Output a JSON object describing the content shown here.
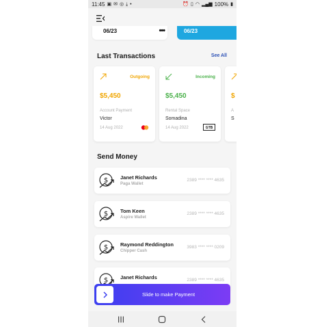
{
  "status_bar": {
    "time": "11:45",
    "battery": "100%",
    "left_icons": [
      "image-icon",
      "message-icon",
      "whatsapp-icon",
      "download-icon",
      "dot-icon"
    ],
    "right_icons": [
      "alarm-icon",
      "vibrate-icon",
      "wifi-icon",
      "signal-icon",
      "battery-icon"
    ]
  },
  "cards": {
    "left_expiry": "06/23",
    "left_mask": "•••",
    "right_expiry": "06/23",
    "right_color": "#1ea7e0"
  },
  "transactions": {
    "title": "Last Transactions",
    "see_all": "See All",
    "items": [
      {
        "type": "Outgoing",
        "amount": "$5,450",
        "purpose": "Account Payment",
        "party": "Victor",
        "date": "14 Aug 2022",
        "color": "#f0a500",
        "logo": "mastercard-icon"
      },
      {
        "type": "Incoming",
        "amount": "$5,450",
        "purpose": "Rental Space",
        "party": "Somadina",
        "date": "14 Aug 2022",
        "color": "#48b048",
        "logo": "gtb-logo",
        "logo_text": "GTB"
      },
      {
        "type": "",
        "amount": "$",
        "purpose": "A",
        "party": "S",
        "date": "",
        "color": "#f0a500"
      }
    ]
  },
  "send_money": {
    "title": "Send Money",
    "items": [
      {
        "name": "Janet Richards",
        "wallet": "Paga Wallet",
        "number": "2389 **** **** 4635"
      },
      {
        "name": "Tom Keen",
        "wallet": "Aspire Wallet",
        "number": "2389 **** **** 4635"
      },
      {
        "name": "Raymond Reddington",
        "wallet": "Chipper Cash",
        "number": "3983 **** **** 0209"
      },
      {
        "name": "Janet Richards",
        "wallet": "",
        "number": "2389 **** **** 4635"
      }
    ]
  },
  "slide": {
    "label": "Slide to make Payment",
    "gradient_start": "#3b3ff0",
    "gradient_end": "#7c3cf4"
  },
  "nav": {
    "recents_icon": "recents-icon",
    "home_icon": "home-icon",
    "back_icon": "back-icon"
  }
}
